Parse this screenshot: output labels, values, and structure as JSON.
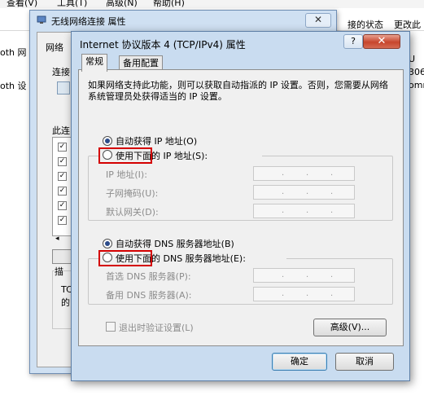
{
  "background": {
    "menu": [
      "查看(V)",
      "工具(T)",
      "高级(N)",
      "帮助(H)"
    ],
    "right_cols": [
      "接的状态",
      "更改此"
    ],
    "left_fragments": [
      "oth 网",
      "oth 设"
    ],
    "right_fragments": [
      "U",
      "306",
      "omm"
    ]
  },
  "dialog1": {
    "title": "无线网络连接 属性",
    "close": "✕",
    "tab_network": "网络",
    "connect_label": "连接",
    "this_conn_label": "此连",
    "desc_label": "描",
    "desc_text1": "TC",
    "desc_text2": "的"
  },
  "dialog2": {
    "title": "Internet 协议版本 4 (TCP/IPv4) 属性",
    "help": "?",
    "close": "✕",
    "tabs": [
      {
        "label": "常规"
      },
      {
        "label": "备用配置"
      }
    ],
    "description": "如果网络支持此功能，则可以获取自动指派的 IP 设置。否则，您需要从网络系统管理员处获得适当的 IP 设置。",
    "ip": {
      "auto_label": "自动获得 IP 地址(O)",
      "manual_label": "使用下面的 IP 地址(S):",
      "fields": [
        {
          "label": "IP 地址(I):",
          "value": ". . ."
        },
        {
          "label": "子网掩码(U):",
          "value": ". . ."
        },
        {
          "label": "默认网关(D):",
          "value": ". . ."
        }
      ]
    },
    "dns": {
      "auto_label": "自动获得 DNS 服务器地址(B)",
      "manual_label": "使用下面的 DNS 服务器地址(E):",
      "fields": [
        {
          "label": "首选 DNS 服务器(P):",
          "value": ". . ."
        },
        {
          "label": "备用 DNS 服务器(A):",
          "value": ". . ."
        }
      ]
    },
    "validate_label": "退出时验证设置(L)",
    "advanced_button": "高级(V)...",
    "ok_button": "确定",
    "cancel_button": "取消"
  },
  "colors": {
    "highlight": "#d40000",
    "close_red": "#c7452c"
  }
}
